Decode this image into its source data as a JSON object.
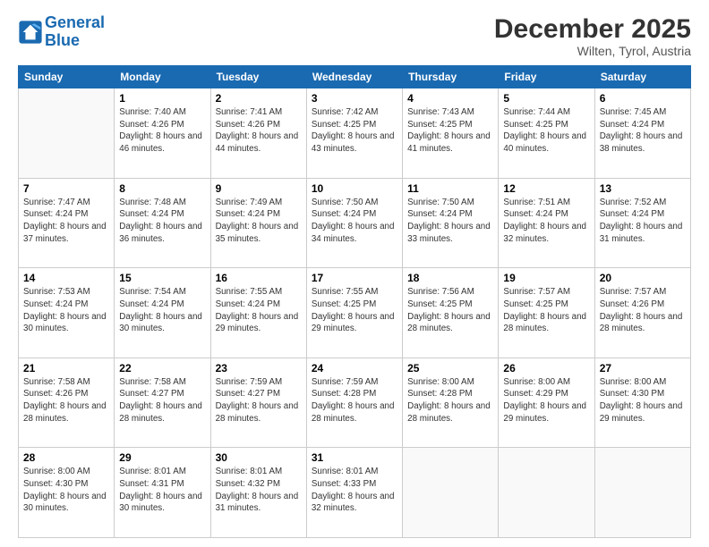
{
  "logo": {
    "line1": "General",
    "line2": "Blue"
  },
  "title": "December 2025",
  "location": "Wilten, Tyrol, Austria",
  "weekdays": [
    "Sunday",
    "Monday",
    "Tuesday",
    "Wednesday",
    "Thursday",
    "Friday",
    "Saturday"
  ],
  "weeks": [
    [
      {
        "day": "",
        "sunrise": "",
        "sunset": "",
        "daylight": ""
      },
      {
        "day": "1",
        "sunrise": "7:40 AM",
        "sunset": "4:26 PM",
        "daylight": "8 hours and 46 minutes."
      },
      {
        "day": "2",
        "sunrise": "7:41 AM",
        "sunset": "4:26 PM",
        "daylight": "8 hours and 44 minutes."
      },
      {
        "day": "3",
        "sunrise": "7:42 AM",
        "sunset": "4:25 PM",
        "daylight": "8 hours and 43 minutes."
      },
      {
        "day": "4",
        "sunrise": "7:43 AM",
        "sunset": "4:25 PM",
        "daylight": "8 hours and 41 minutes."
      },
      {
        "day": "5",
        "sunrise": "7:44 AM",
        "sunset": "4:25 PM",
        "daylight": "8 hours and 40 minutes."
      },
      {
        "day": "6",
        "sunrise": "7:45 AM",
        "sunset": "4:24 PM",
        "daylight": "8 hours and 38 minutes."
      }
    ],
    [
      {
        "day": "7",
        "sunrise": "7:47 AM",
        "sunset": "4:24 PM",
        "daylight": "8 hours and 37 minutes."
      },
      {
        "day": "8",
        "sunrise": "7:48 AM",
        "sunset": "4:24 PM",
        "daylight": "8 hours and 36 minutes."
      },
      {
        "day": "9",
        "sunrise": "7:49 AM",
        "sunset": "4:24 PM",
        "daylight": "8 hours and 35 minutes."
      },
      {
        "day": "10",
        "sunrise": "7:50 AM",
        "sunset": "4:24 PM",
        "daylight": "8 hours and 34 minutes."
      },
      {
        "day": "11",
        "sunrise": "7:50 AM",
        "sunset": "4:24 PM",
        "daylight": "8 hours and 33 minutes."
      },
      {
        "day": "12",
        "sunrise": "7:51 AM",
        "sunset": "4:24 PM",
        "daylight": "8 hours and 32 minutes."
      },
      {
        "day": "13",
        "sunrise": "7:52 AM",
        "sunset": "4:24 PM",
        "daylight": "8 hours and 31 minutes."
      }
    ],
    [
      {
        "day": "14",
        "sunrise": "7:53 AM",
        "sunset": "4:24 PM",
        "daylight": "8 hours and 30 minutes."
      },
      {
        "day": "15",
        "sunrise": "7:54 AM",
        "sunset": "4:24 PM",
        "daylight": "8 hours and 30 minutes."
      },
      {
        "day": "16",
        "sunrise": "7:55 AM",
        "sunset": "4:24 PM",
        "daylight": "8 hours and 29 minutes."
      },
      {
        "day": "17",
        "sunrise": "7:55 AM",
        "sunset": "4:25 PM",
        "daylight": "8 hours and 29 minutes."
      },
      {
        "day": "18",
        "sunrise": "7:56 AM",
        "sunset": "4:25 PM",
        "daylight": "8 hours and 28 minutes."
      },
      {
        "day": "19",
        "sunrise": "7:57 AM",
        "sunset": "4:25 PM",
        "daylight": "8 hours and 28 minutes."
      },
      {
        "day": "20",
        "sunrise": "7:57 AM",
        "sunset": "4:26 PM",
        "daylight": "8 hours and 28 minutes."
      }
    ],
    [
      {
        "day": "21",
        "sunrise": "7:58 AM",
        "sunset": "4:26 PM",
        "daylight": "8 hours and 28 minutes."
      },
      {
        "day": "22",
        "sunrise": "7:58 AM",
        "sunset": "4:27 PM",
        "daylight": "8 hours and 28 minutes."
      },
      {
        "day": "23",
        "sunrise": "7:59 AM",
        "sunset": "4:27 PM",
        "daylight": "8 hours and 28 minutes."
      },
      {
        "day": "24",
        "sunrise": "7:59 AM",
        "sunset": "4:28 PM",
        "daylight": "8 hours and 28 minutes."
      },
      {
        "day": "25",
        "sunrise": "8:00 AM",
        "sunset": "4:28 PM",
        "daylight": "8 hours and 28 minutes."
      },
      {
        "day": "26",
        "sunrise": "8:00 AM",
        "sunset": "4:29 PM",
        "daylight": "8 hours and 29 minutes."
      },
      {
        "day": "27",
        "sunrise": "8:00 AM",
        "sunset": "4:30 PM",
        "daylight": "8 hours and 29 minutes."
      }
    ],
    [
      {
        "day": "28",
        "sunrise": "8:00 AM",
        "sunset": "4:30 PM",
        "daylight": "8 hours and 30 minutes."
      },
      {
        "day": "29",
        "sunrise": "8:01 AM",
        "sunset": "4:31 PM",
        "daylight": "8 hours and 30 minutes."
      },
      {
        "day": "30",
        "sunrise": "8:01 AM",
        "sunset": "4:32 PM",
        "daylight": "8 hours and 31 minutes."
      },
      {
        "day": "31",
        "sunrise": "8:01 AM",
        "sunset": "4:33 PM",
        "daylight": "8 hours and 32 minutes."
      },
      {
        "day": "",
        "sunrise": "",
        "sunset": "",
        "daylight": ""
      },
      {
        "day": "",
        "sunrise": "",
        "sunset": "",
        "daylight": ""
      },
      {
        "day": "",
        "sunrise": "",
        "sunset": "",
        "daylight": ""
      }
    ]
  ],
  "labels": {
    "sunrise_prefix": "Sunrise: ",
    "sunset_prefix": "Sunset: ",
    "daylight_prefix": "Daylight: "
  }
}
